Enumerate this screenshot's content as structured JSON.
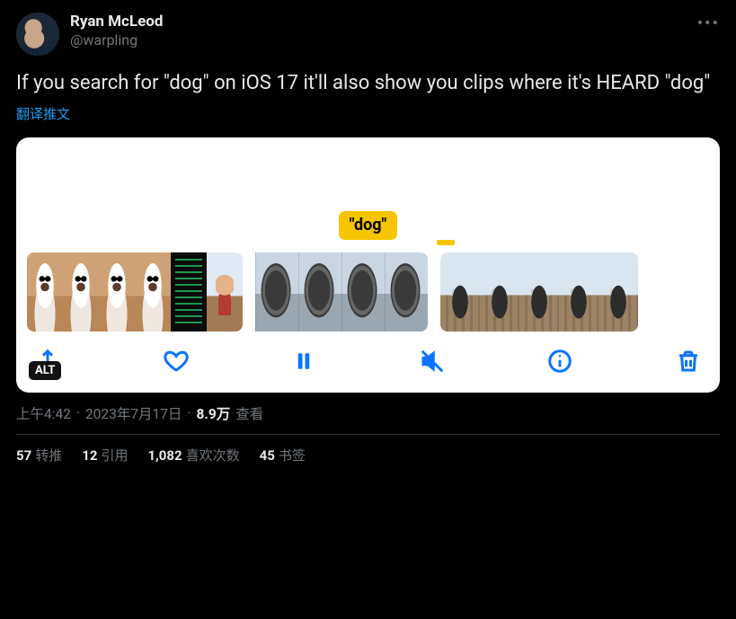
{
  "author": {
    "name": "Ryan McLeod",
    "handle": "@warpling"
  },
  "tweet_text": "If you search for \"dog\" on iOS 17 it'll also show you clips where it's HEARD \"dog\"",
  "translate_label": "翻译推文",
  "media": {
    "tag_text": "\"dog\"",
    "alt_badge": "ALT",
    "toolbar": {
      "share": "share",
      "like": "like",
      "pause": "pause",
      "mute": "mute",
      "info": "info",
      "delete": "delete"
    }
  },
  "meta": {
    "time": "上午4:42",
    "date": "2023年7月17日",
    "views_count": "8.9万",
    "views_label": "查看",
    "sep": " · "
  },
  "stats": {
    "retweets": {
      "count": "57",
      "label": "转推"
    },
    "quotes": {
      "count": "12",
      "label": "引用"
    },
    "likes": {
      "count": "1,082",
      "label": "喜欢次数"
    },
    "bookmarks": {
      "count": "45",
      "label": "书签"
    }
  }
}
